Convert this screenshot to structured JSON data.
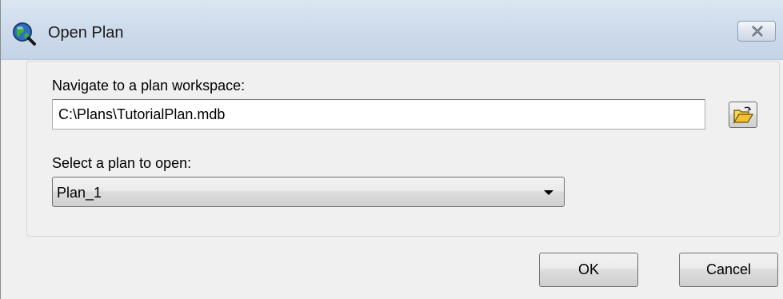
{
  "window": {
    "title": "Open Plan",
    "app_icon": "globe-magnifier-icon",
    "close_icon": "close-icon"
  },
  "workspace": {
    "label": "Navigate to a plan workspace:",
    "path_value": "C:\\Plans\\TutorialPlan.mdb",
    "browse_icon": "open-folder-icon"
  },
  "plan": {
    "label": "Select a plan to open:",
    "selected": "Plan_1"
  },
  "buttons": {
    "ok_label": "OK",
    "cancel_label": "Cancel"
  },
  "colors": {
    "titlebar": "#cfdcec",
    "dialog_background": "#f0f0f0",
    "folder_icon": "#f2c037"
  }
}
